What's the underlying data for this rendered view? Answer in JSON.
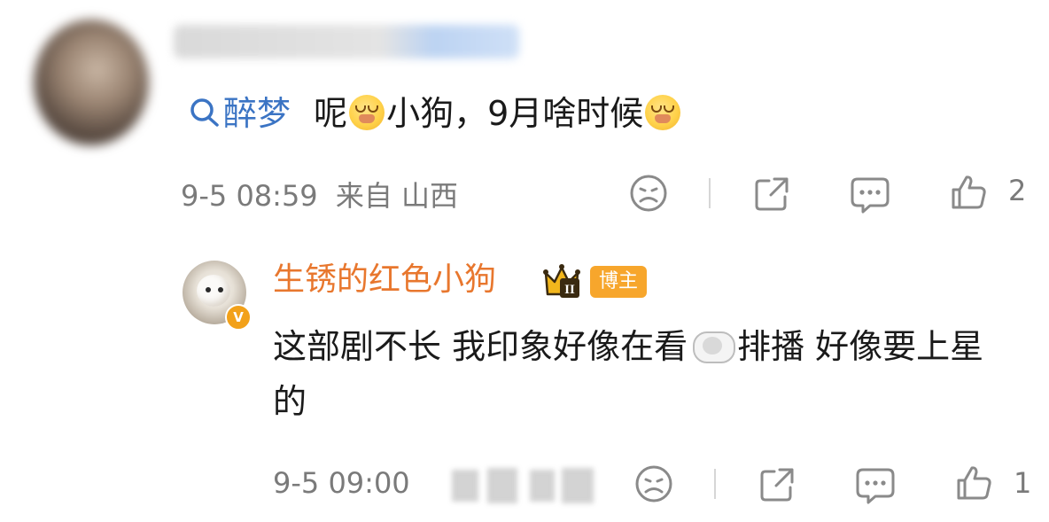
{
  "comment": {
    "topic": "醉梦",
    "text_before": "呢",
    "text_middle": "小狗，9月啥时候",
    "timestamp": "9-5 08:59",
    "location": "来自 山西",
    "like_count": "2",
    "emoji": "cry-emoji"
  },
  "reply": {
    "username": "生锈的红色小狗",
    "role_tag": "博主",
    "crown_level": "II",
    "verified_badge": "V",
    "text_part1": "这部剧不长 我印象好像在看",
    "text_part2": "排播 好像要上星的",
    "timestamp": "9-5 09:00",
    "like_count": "1"
  },
  "colors": {
    "topic_link": "#3b74c4",
    "username": "#e8772e",
    "tag_bg": "#f7a62c",
    "meta_text": "#7a7a7a"
  },
  "icons": [
    "search-icon",
    "sad-face-icon",
    "share-icon",
    "comment-icon",
    "like-icon",
    "crown-icon",
    "sheep-emoji",
    "cry-emoji"
  ]
}
